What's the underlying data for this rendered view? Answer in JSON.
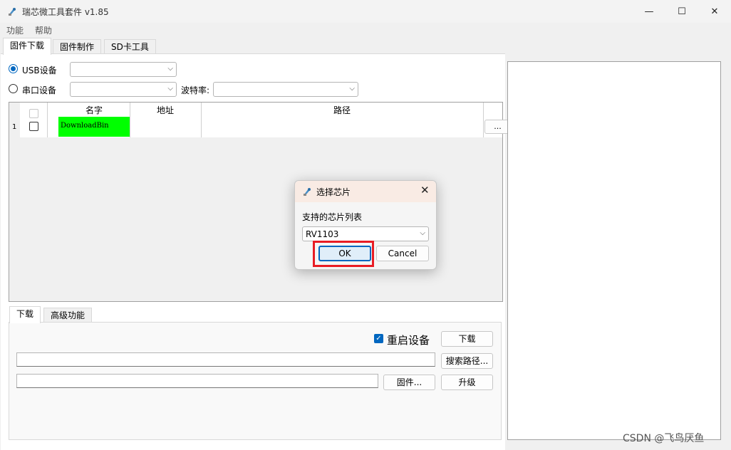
{
  "window": {
    "title": "瑞芯微工具套件 v1.85",
    "minimize": "—",
    "maximize": "☐",
    "close": "✕"
  },
  "menu": [
    "功能",
    "帮助"
  ],
  "main_tabs": [
    "固件下载",
    "固件制作",
    "SD卡工具"
  ],
  "device": {
    "usb_label": "USB设备",
    "serial_label": "串口设备",
    "baud_label": "波特率:",
    "usb_selected": true
  },
  "grid": {
    "headers": [
      "名字",
      "地址",
      "路径"
    ],
    "rows": [
      {
        "num": "1",
        "name": "DownloadBin",
        "address": "",
        "path": "",
        "browse": "..."
      }
    ]
  },
  "bottom_tabs": [
    "下载",
    "高级功能"
  ],
  "download": {
    "restart_label": "重启设备",
    "restart_checked": true,
    "download_button": "下载",
    "search_path_button": "搜索路径...",
    "firmware_button": "固件...",
    "upgrade_button": "升级"
  },
  "dialog": {
    "title": "选择芯片",
    "close": "✕",
    "label": "支持的芯片列表",
    "selected_chip": "RV1103",
    "ok": "OK",
    "cancel": "Cancel"
  },
  "watermark": "CSDN @飞鸟厌鱼"
}
